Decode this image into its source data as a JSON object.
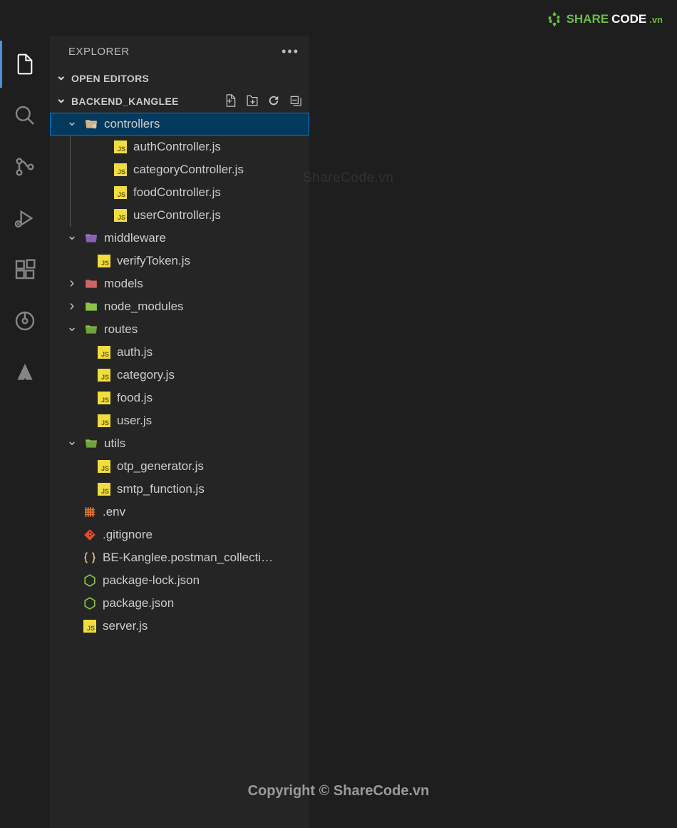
{
  "watermark": {
    "share": "SHARE",
    "code": "CODE",
    "vn": ".vn"
  },
  "sidebar": {
    "title": "EXPLORER",
    "openEditors": "OPEN EDITORS",
    "project": "BACKEND_KANGLEE"
  },
  "tree": {
    "controllers": {
      "name": "controllers",
      "files": [
        "authController.js",
        "categoryController.js",
        "foodController.js",
        "userController.js"
      ]
    },
    "middleware": {
      "name": "middleware",
      "files": [
        "verifyToken.js"
      ]
    },
    "models": {
      "name": "models"
    },
    "node_modules": {
      "name": "node_modules"
    },
    "routes": {
      "name": "routes",
      "files": [
        "auth.js",
        "category.js",
        "food.js",
        "user.js"
      ]
    },
    "utils": {
      "name": "utils",
      "files": [
        "otp_generator.js",
        "smtp_function.js"
      ]
    },
    "rootFiles": {
      "env": ".env",
      "gitignore": ".gitignore",
      "postman": "BE-Kanglee.postman_collecti…",
      "packageLock": "package-lock.json",
      "package": "package.json",
      "server": "server.js"
    }
  },
  "centerWatermark": "ShareCode.vn",
  "copyright": "Copyright © ShareCode.vn"
}
